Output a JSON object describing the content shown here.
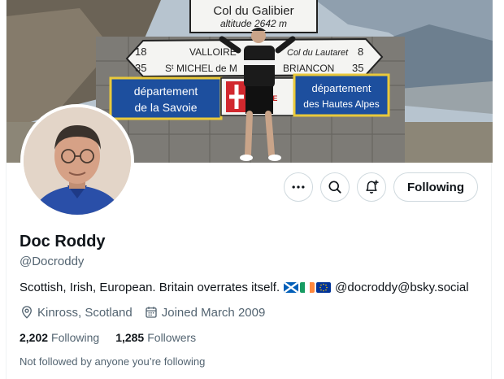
{
  "banner": {
    "sign_top_line1": "Col du Galibier",
    "sign_top_line2": "altitude 2642 m",
    "sign_mid_left_top": "18",
    "sign_mid_left_bottom": "35",
    "sign_mid_text_top": "VALLOIRE",
    "sign_mid_text_top_right": "Col du Lautaret",
    "sign_mid_text_bottom": "Sᵗ MICHEL de M",
    "sign_mid_text_bottom_right": "BRIANCON",
    "sign_mid_right_top": "8",
    "sign_mid_right_bottom": "35",
    "sign_left_line1": "département",
    "sign_left_line2": "de la Savoie",
    "sign_center": "SAVOIE",
    "sign_right_line1": "département",
    "sign_right_line2": "des Hautes Alpes"
  },
  "actions": {
    "more_icon": "more-icon",
    "search_icon": "search-icon",
    "notify_icon": "bell-plus-icon",
    "follow_label": "Following"
  },
  "profile": {
    "name": "Doc Roddy",
    "handle": "@Docroddy",
    "bio_text": "Scottish, Irish, European. Britain overrates itself.",
    "bio_flags": [
      "scotland-flag",
      "ireland-flag",
      "eu-flag"
    ],
    "bio_link": "@docroddy@bsky.social",
    "location": "Kinross, Scotland",
    "joined": "Joined March 2009",
    "following_count": "2,202",
    "following_label": "Following",
    "followers_count": "1,285",
    "followers_label": "Followers",
    "mutual_text": "Not followed by anyone you’re following"
  },
  "colors": {
    "text_primary": "#0f1419",
    "text_secondary": "#536471",
    "border": "#cfd9de",
    "sign_blue": "#1d4f9e"
  }
}
